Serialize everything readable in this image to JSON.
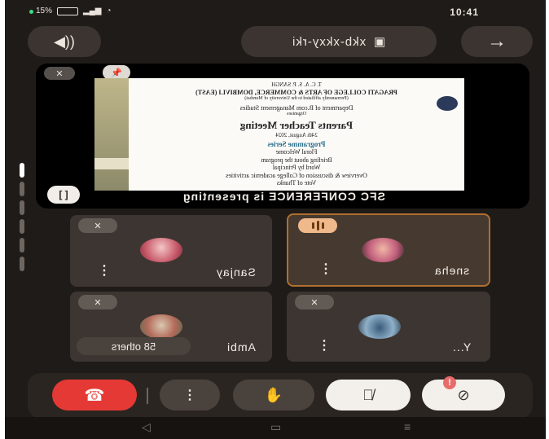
{
  "status_bar": {
    "time": "10:41",
    "battery": "15%",
    "left_icons": "▯ 10:41 ⌂ ✉ ▮▯ ll LTE Ill ul"
  },
  "header": {
    "meeting_code": "xkb-xkxy-rki",
    "back_icon": "arrow-right-icon",
    "audio_icon": "speaker-icon"
  },
  "presentation": {
    "caption": "SFC CONFERENCE is presenting",
    "slide": {
      "org": "T. C. A. S. P. SANGH",
      "college": "PRAGATI COLLEGE OF ARTS & COMMERCE, DOMBIVLI (EAST)",
      "affiliation": "(Permanently affiliated to the University of Mumbai)",
      "dept": "Department of B.com Management Studies",
      "organises": "Organises",
      "title": "Parents Teacher Meeting",
      "date": "24th August, 2024",
      "series": "Programme Series",
      "items": [
        "Floral Welcome",
        "Briefing about the program",
        "Word by Principal",
        "Overview & discussion of College academic activities",
        "Vote of Thanks"
      ]
    }
  },
  "participants": [
    {
      "name": "Sanjay",
      "muted": true
    },
    {
      "name": "sneha",
      "speaking": true
    },
    {
      "name": "Ambi",
      "others_label": "58 others",
      "muted": true
    },
    {
      "name": "Y...",
      "muted": true
    }
  ],
  "controls": {
    "end_call_icon": "phone-hangup-icon",
    "more_icon": "more-vertical-icon",
    "hand_icon": "raise-hand-icon",
    "mic_icon": "mic-off-icon",
    "camera_icon": "camera-off-icon",
    "alert_label": "!"
  },
  "colors": {
    "background": "#1f1b18",
    "tile": "#3d3531",
    "speaking_border": "#b06e2e",
    "end_call": "#e53935"
  }
}
